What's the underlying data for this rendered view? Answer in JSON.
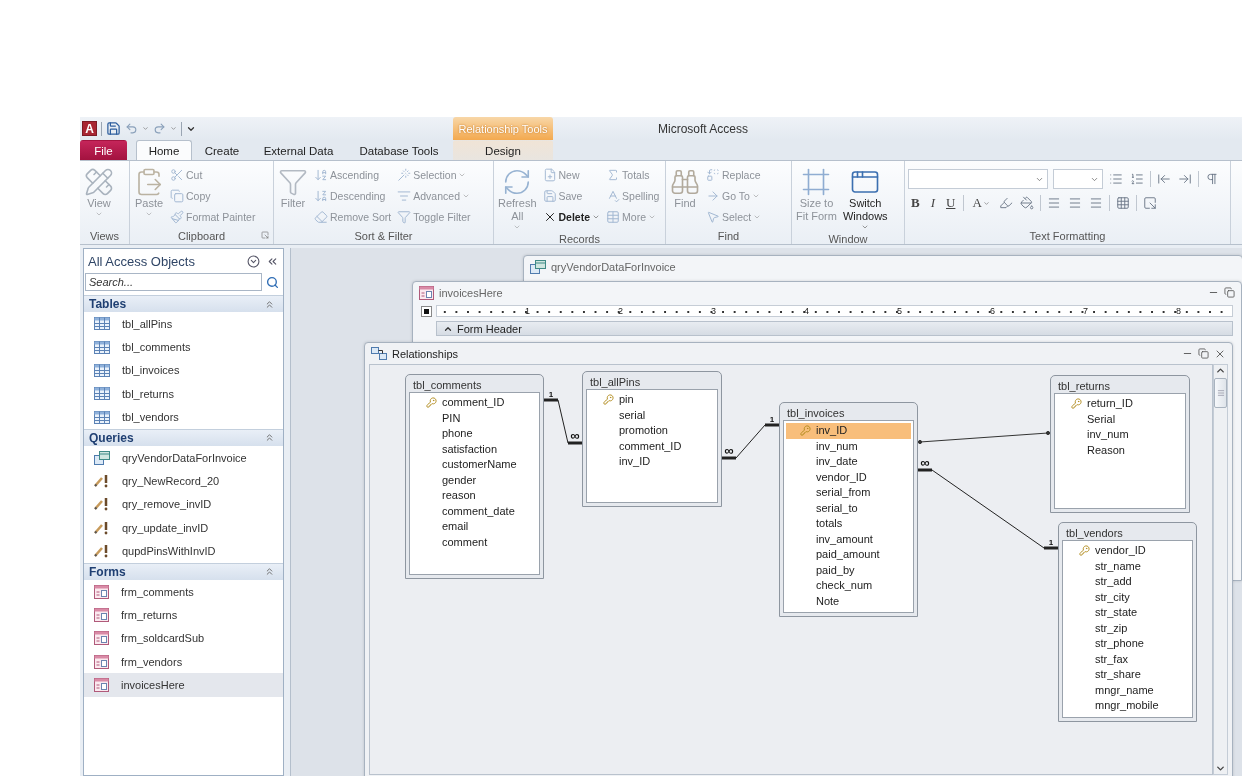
{
  "quick_access": {
    "logo": "A"
  },
  "title_bar": {
    "context_label": "Relationship Tools",
    "title": "Microsoft Access"
  },
  "tabs": [
    {
      "label": "File",
      "kind": "file",
      "selected": false
    },
    {
      "label": "Home",
      "kind": "tab",
      "selected": true
    },
    {
      "label": "Create",
      "kind": "tab",
      "selected": false
    },
    {
      "label": "External Data",
      "kind": "tab",
      "selected": false
    },
    {
      "label": "Database Tools",
      "kind": "tab",
      "selected": false
    },
    {
      "label": "Design",
      "kind": "contextual",
      "selected": false
    }
  ],
  "ribbon": {
    "groups": [
      {
        "label": "Views",
        "kind": "buttons",
        "launcher": false,
        "columns": [
          {
            "kind": "large",
            "buttons": [
              {
                "lines": [
                  "View"
                ],
                "dropdown": true,
                "disabled": true
              }
            ]
          }
        ]
      },
      {
        "label": "Clipboard",
        "kind": "buttons",
        "launcher": true,
        "columns": [
          {
            "kind": "large",
            "buttons": [
              {
                "lines": [
                  "Paste"
                ],
                "dropdown": true,
                "disabled": true
              }
            ]
          },
          {
            "kind": "small",
            "buttons": [
              {
                "lines": [
                  "Cut"
                ],
                "dropdown": false,
                "disabled": true
              },
              {
                "lines": [
                  "Copy"
                ],
                "dropdown": false,
                "disabled": true
              },
              {
                "lines": [
                  "Format Painter"
                ],
                "dropdown": false,
                "disabled": true
              }
            ]
          }
        ]
      },
      {
        "label": "Sort & Filter",
        "kind": "buttons",
        "launcher": false,
        "columns": [
          {
            "kind": "large",
            "buttons": [
              {
                "lines": [
                  "Filter"
                ],
                "dropdown": false,
                "disabled": true
              }
            ]
          },
          {
            "kind": "small",
            "buttons": [
              {
                "lines": [
                  "Ascending"
                ],
                "dropdown": false,
                "disabled": true
              },
              {
                "lines": [
                  "Descending"
                ],
                "dropdown": false,
                "disabled": true
              },
              {
                "lines": [
                  "Remove Sort"
                ],
                "dropdown": false,
                "disabled": true
              }
            ]
          },
          {
            "kind": "small",
            "buttons": [
              {
                "lines": [
                  "Selection"
                ],
                "dropdown": true,
                "disabled": true
              },
              {
                "lines": [
                  "Advanced"
                ],
                "dropdown": true,
                "disabled": true
              },
              {
                "lines": [
                  "Toggle Filter"
                ],
                "dropdown": false,
                "disabled": true
              }
            ]
          }
        ]
      },
      {
        "label": "Records",
        "kind": "buttons",
        "launcher": false,
        "columns": [
          {
            "kind": "large",
            "buttons": [
              {
                "lines": [
                  "Refresh",
                  "All"
                ],
                "dropdown": true,
                "disabled": true
              }
            ]
          },
          {
            "kind": "small",
            "buttons": [
              {
                "lines": [
                  "New"
                ],
                "dropdown": false,
                "disabled": true
              },
              {
                "lines": [
                  "Save"
                ],
                "dropdown": false,
                "disabled": true
              },
              {
                "lines": [
                  "Delete"
                ],
                "dropdown": true,
                "disabled": false
              }
            ]
          },
          {
            "kind": "small",
            "buttons": [
              {
                "lines": [
                  "Totals"
                ],
                "dropdown": false,
                "disabled": true
              },
              {
                "lines": [
                  "Spelling"
                ],
                "dropdown": false,
                "disabled": true
              },
              {
                "lines": [
                  "More"
                ],
                "dropdown": true,
                "disabled": true
              }
            ]
          }
        ]
      },
      {
        "label": "Find",
        "kind": "buttons",
        "launcher": false,
        "columns": [
          {
            "kind": "large",
            "buttons": [
              {
                "lines": [
                  "Find"
                ],
                "dropdown": false,
                "disabled": true
              }
            ]
          },
          {
            "kind": "small",
            "buttons": [
              {
                "lines": [
                  "Replace"
                ],
                "dropdown": false,
                "disabled": true
              },
              {
                "lines": [
                  "Go To"
                ],
                "dropdown": true,
                "disabled": true
              },
              {
                "lines": [
                  "Select"
                ],
                "dropdown": true,
                "disabled": true
              }
            ]
          }
        ]
      },
      {
        "label": "Window",
        "kind": "buttons",
        "launcher": false,
        "columns": [
          {
            "kind": "large",
            "buttons": [
              {
                "lines": [
                  "Size to",
                  "Fit Form"
                ],
                "dropdown": false,
                "disabled": true
              }
            ]
          },
          {
            "kind": "large",
            "buttons": [
              {
                "lines": [
                  "Switch",
                  "Windows"
                ],
                "dropdown": true,
                "disabled": false
              }
            ]
          }
        ]
      },
      {
        "label": "Text Formatting",
        "kind": "formatting",
        "launcher": false,
        "format_keys": [
          {
            "label": "B",
            "kind": "bold"
          },
          {
            "label": "I",
            "kind": "italic"
          },
          {
            "label": "U",
            "kind": "underline"
          },
          {
            "label": "A",
            "kind": "font_color"
          }
        ]
      }
    ]
  },
  "nav_pane": {
    "title": "All Access Objects",
    "search": {
      "placeholder": "Search..."
    },
    "sections": [
      {
        "label": "Tables",
        "expanded": true,
        "items": [
          {
            "label": "tbl_allPins",
            "kind": "table",
            "selected": false
          },
          {
            "label": "tbl_comments",
            "kind": "table",
            "selected": false
          },
          {
            "label": "tbl_invoices",
            "kind": "table",
            "selected": false
          },
          {
            "label": "tbl_returns",
            "kind": "table",
            "selected": false
          },
          {
            "label": "tbl_vendors",
            "kind": "table",
            "selected": false
          }
        ]
      },
      {
        "label": "Queries",
        "expanded": true,
        "items": [
          {
            "label": "qryVendorDataForInvoice",
            "kind": "select_query",
            "selected": false
          },
          {
            "label": "qry_NewRecord_20",
            "kind": "update_query",
            "selected": false
          },
          {
            "label": "qry_remove_invID",
            "kind": "update_query",
            "selected": false
          },
          {
            "label": "qry_update_invID",
            "kind": "update_query",
            "selected": false
          },
          {
            "label": "qupdPinsWithInvID",
            "kind": "update_query",
            "selected": false
          }
        ]
      },
      {
        "label": "Forms",
        "expanded": true,
        "items": [
          {
            "label": "frm_comments",
            "kind": "form",
            "selected": false
          },
          {
            "label": "frm_returns",
            "kind": "form",
            "selected": false
          },
          {
            "label": "frm_soldcardSub",
            "kind": "form",
            "selected": false
          },
          {
            "label": "frm_vendors",
            "kind": "form",
            "selected": false
          },
          {
            "label": "invoicesHere",
            "kind": "form",
            "selected": true
          }
        ]
      }
    ]
  },
  "documents": [
    {
      "title": "qryVendorDataForInvoice",
      "kind": "query"
    },
    {
      "title": "invoicesHere",
      "kind": "form",
      "ruler_numbers": [
        "1",
        "2",
        "3",
        "4",
        "5",
        "6",
        "7",
        "8"
      ],
      "section": "Form Header"
    }
  ],
  "relationships_window": {
    "title": "Relationships",
    "tables": [
      {
        "name": "tbl_comments",
        "fields": [
          {
            "name": "comment_ID",
            "primary_key": true,
            "selected": false
          },
          {
            "name": "PIN",
            "primary_key": false,
            "selected": false
          },
          {
            "name": "phone",
            "primary_key": false,
            "selected": false
          },
          {
            "name": "satisfaction",
            "primary_key": false,
            "selected": false
          },
          {
            "name": "customerName",
            "primary_key": false,
            "selected": false
          },
          {
            "name": "gender",
            "primary_key": false,
            "selected": false
          },
          {
            "name": "reason",
            "primary_key": false,
            "selected": false
          },
          {
            "name": "comment_date",
            "primary_key": false,
            "selected": false
          },
          {
            "name": "email",
            "primary_key": false,
            "selected": false
          },
          {
            "name": "comment",
            "primary_key": false,
            "selected": false
          }
        ]
      },
      {
        "name": "tbl_allPins",
        "fields": [
          {
            "name": "pin",
            "primary_key": true,
            "selected": false
          },
          {
            "name": "serial",
            "primary_key": false,
            "selected": false
          },
          {
            "name": "promotion",
            "primary_key": false,
            "selected": false
          },
          {
            "name": "comment_ID",
            "primary_key": false,
            "selected": false
          },
          {
            "name": "inv_ID",
            "primary_key": false,
            "selected": false
          }
        ]
      },
      {
        "name": "tbl_invoices",
        "fields": [
          {
            "name": "inv_ID",
            "primary_key": true,
            "selected": true
          },
          {
            "name": "inv_num",
            "primary_key": false,
            "selected": false
          },
          {
            "name": "inv_date",
            "primary_key": false,
            "selected": false
          },
          {
            "name": "vendor_ID",
            "primary_key": false,
            "selected": false
          },
          {
            "name": "serial_from",
            "primary_key": false,
            "selected": false
          },
          {
            "name": "serial_to",
            "primary_key": false,
            "selected": false
          },
          {
            "name": "totals",
            "primary_key": false,
            "selected": false
          },
          {
            "name": "inv_amount",
            "primary_key": false,
            "selected": false
          },
          {
            "name": "paid_amount",
            "primary_key": false,
            "selected": false
          },
          {
            "name": "paid_by",
            "primary_key": false,
            "selected": false
          },
          {
            "name": "check_num",
            "primary_key": false,
            "selected": false
          },
          {
            "name": "Note",
            "primary_key": false,
            "selected": false
          }
        ]
      },
      {
        "name": "tbl_returns",
        "fields": [
          {
            "name": "return_ID",
            "primary_key": true,
            "selected": false
          },
          {
            "name": "Serial",
            "primary_key": false,
            "selected": false
          },
          {
            "name": "inv_num",
            "primary_key": false,
            "selected": false
          },
          {
            "name": "Reason",
            "primary_key": false,
            "selected": false
          }
        ]
      },
      {
        "name": "tbl_vendors",
        "fields": [
          {
            "name": "vendor_ID",
            "primary_key": true,
            "selected": false
          },
          {
            "name": "str_name",
            "primary_key": false,
            "selected": false
          },
          {
            "name": "str_add",
            "primary_key": false,
            "selected": false
          },
          {
            "name": "str_city",
            "primary_key": false,
            "selected": false
          },
          {
            "name": "str_state",
            "primary_key": false,
            "selected": false
          },
          {
            "name": "str_zip",
            "primary_key": false,
            "selected": false
          },
          {
            "name": "str_phone",
            "primary_key": false,
            "selected": false
          },
          {
            "name": "str_fax",
            "primary_key": false,
            "selected": false
          },
          {
            "name": "str_share",
            "primary_key": false,
            "selected": false
          },
          {
            "name": "mngr_name",
            "primary_key": false,
            "selected": false
          },
          {
            "name": "mngr_mobile",
            "primary_key": false,
            "selected": false
          }
        ]
      }
    ],
    "relationships": [
      {
        "kind": "one_to_many",
        "one_label": "1",
        "many_label": "∞"
      },
      {
        "kind": "one_to_many",
        "one_label": "1",
        "many_label": "∞"
      },
      {
        "kind": "indeterminate"
      },
      {
        "kind": "one_to_many",
        "one_label": "1",
        "many_label": "∞"
      }
    ]
  }
}
